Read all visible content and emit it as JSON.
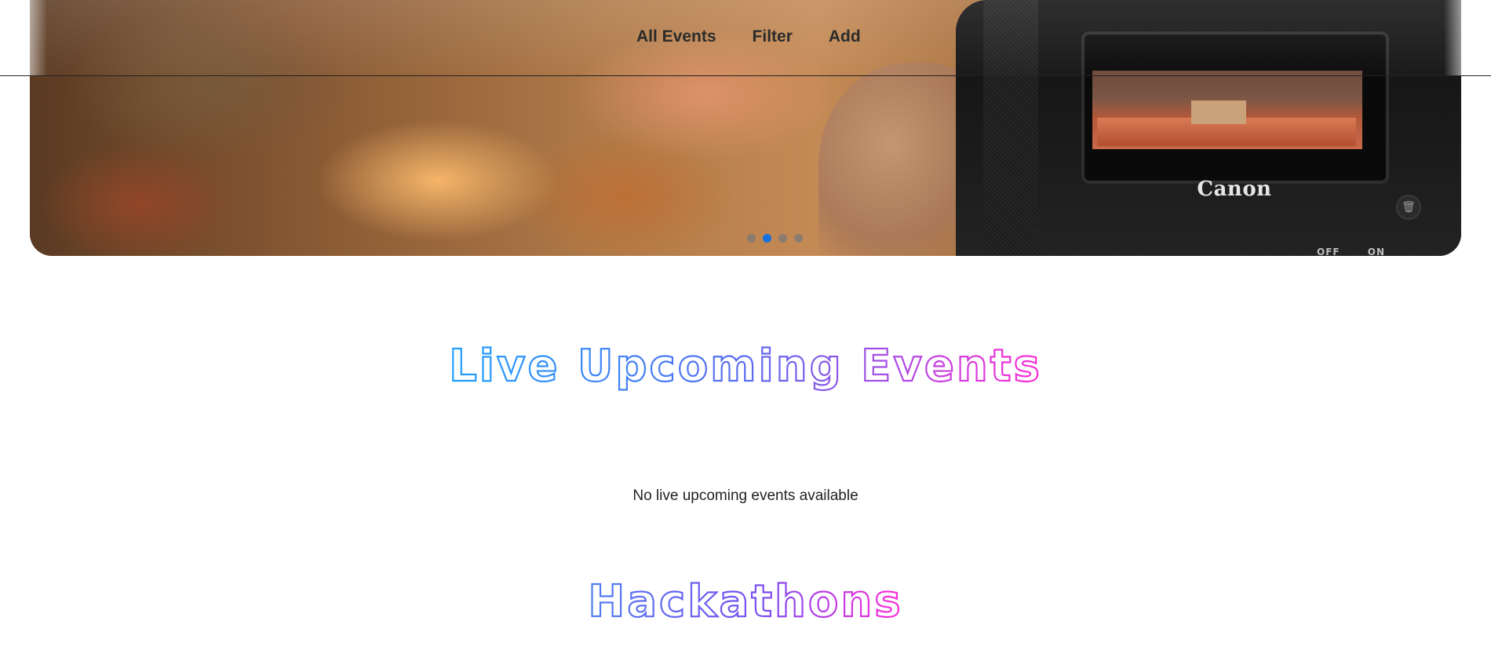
{
  "nav": {
    "links": [
      {
        "label": "All Events"
      },
      {
        "label": "Filter"
      },
      {
        "label": "Add"
      }
    ]
  },
  "carousel": {
    "slide_count": 4,
    "active_index": 1,
    "camera_brand": "Canon",
    "camera_switch": [
      "OFF",
      "ON"
    ],
    "active_dot_color": "#1672e0"
  },
  "sections": {
    "live": {
      "title": "Live Upcoming Events",
      "empty_message": "No live upcoming events available"
    },
    "hackathons": {
      "title": "Hackathons"
    }
  },
  "theme": {
    "gradient_start": "#1ea0ff",
    "gradient_end": "#ff2bd6"
  }
}
